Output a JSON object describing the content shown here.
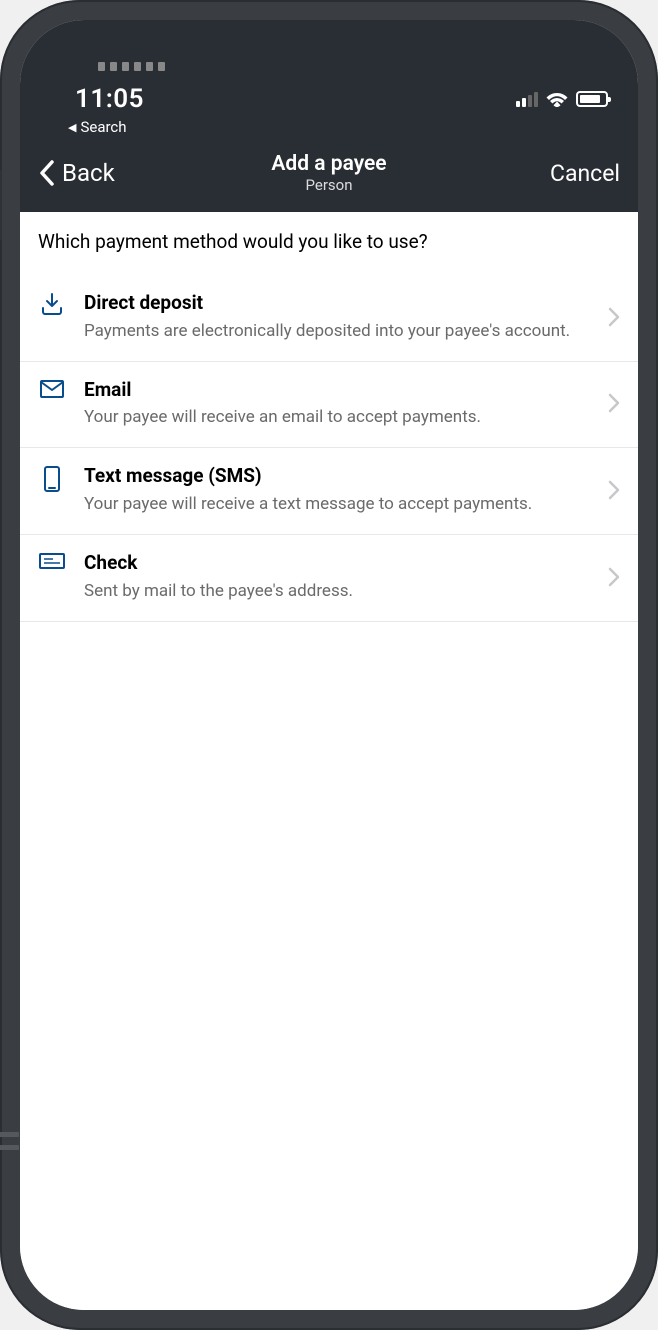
{
  "statusbar": {
    "time": "11:05",
    "search_back": "Search"
  },
  "navbar": {
    "back_label": "Back",
    "title": "Add a payee",
    "subtitle": "Person",
    "cancel_label": "Cancel"
  },
  "content": {
    "prompt": "Which payment method would you like to use?",
    "options": [
      {
        "title": "Direct deposit",
        "description": "Payments are electronically deposited into your payee's account."
      },
      {
        "title": "Email",
        "description": "Your payee will receive an email to accept payments."
      },
      {
        "title": "Text message (SMS)",
        "description": "Your payee will receive a text message to accept payments."
      },
      {
        "title": "Check",
        "description": "Sent by mail to the payee's address."
      }
    ]
  },
  "colors": {
    "accent": "#0a4d8c",
    "header_bg": "#292d34",
    "text_secondary": "#6a6a6a"
  }
}
